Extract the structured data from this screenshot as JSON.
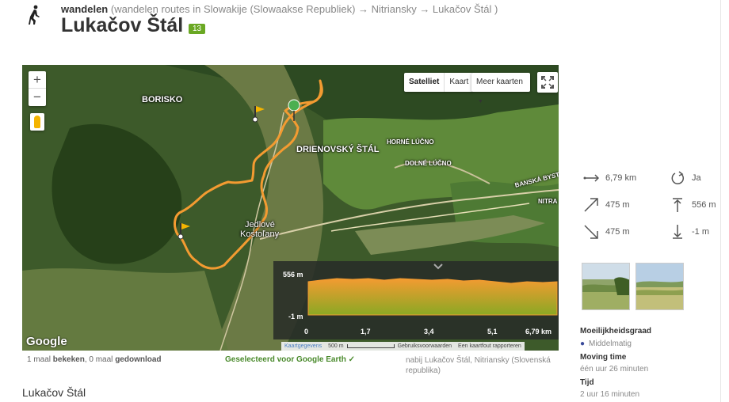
{
  "header": {
    "activity": "wandelen",
    "breadcrumb": "(wandelen routes in Slowakije (Slowaakse Republiek) → Nitriansky → Lukačov Štál )",
    "title": "Lukačov Štál",
    "badge": "13"
  },
  "map": {
    "zoom_in": "+",
    "zoom_out": "−",
    "maptype_satellite": "Satelliet",
    "maptype_map": "Kaart",
    "more_maps": "Meer kaarten",
    "places": {
      "borisko": "BORISKO",
      "drienovsky": "DRIENOVSKÝ ŠTÁL",
      "horne": "HORNÉ LÚČNO",
      "dolne": "DOLNÉ LÚČNO",
      "banska": "BANSKÁ BYST",
      "nitra": "NITRA",
      "jedlove": "Jedlové",
      "kostolany": "Kostoľany"
    },
    "google_logo": "Google",
    "attribution": {
      "data": "Kaartgegevens",
      "scale": "500 m",
      "terms": "Gebruiksvoorwaarden",
      "report": "Een kaartfout rapporteren"
    },
    "profile": {
      "max_label": "556 m",
      "min_label": "-1 m",
      "ticks": [
        "0",
        "1,7",
        "3,4",
        "5,1",
        "6,79 km"
      ]
    }
  },
  "below_map": {
    "stats_prefix": "1 maal ",
    "viewed": "bekeken",
    "stats_mid": ", 0 maal ",
    "downloaded": "gedownload",
    "google_earth": "Geselecteerd voor Google Earth ✓",
    "location": "nabij Lukačov Štál, Nitriansky (Slovenská republika)"
  },
  "bottom_title": "Lukačov Štál",
  "stats": {
    "distance": "6,79 km",
    "loop": "Ja",
    "ascent": "475 m",
    "max_elev": "556 m",
    "descent": "475 m",
    "min_elev": "-1 m"
  },
  "details": {
    "difficulty_label": "Moeilijkheidsgraad",
    "difficulty_value": "Middelmatig",
    "moving_label": "Moving time",
    "moving_value": "één uur 26 minuten",
    "time_label": "Tijd",
    "time_value": "2 uur 16 minuten"
  }
}
